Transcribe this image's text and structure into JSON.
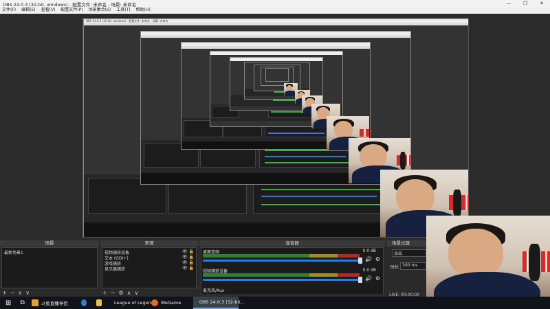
{
  "window": {
    "title": "OBS 24.0.3 (32-bit, windows) - 配置文件: 未命名 - 场景: 未命名",
    "minimize": "—",
    "maximize": "❐",
    "close": "✕"
  },
  "menu": [
    "文件(F)",
    "编辑(E)",
    "查看(V)",
    "配置文件(P)",
    "场景集合(S)",
    "工具(T)",
    "帮助(H)"
  ],
  "nested": {
    "title": "OBS 24.0.3 (32-bit, windows) - 配置文件: 未命名 - 场景: 未命名"
  },
  "scenes": {
    "header": "场景",
    "items": [
      "最新场景1"
    ],
    "tools": [
      "+",
      "−",
      "∧",
      "∨"
    ]
  },
  "sources": {
    "header": "来源",
    "items": [
      "视频捕获设备",
      "文本 (GDI+)",
      "游戏捕获",
      "显示器捕获"
    ],
    "tools": [
      "+",
      "−",
      "⚙",
      "∧",
      "∨"
    ]
  },
  "mixer": {
    "header": "混音器",
    "items": [
      {
        "name": "桌面音频",
        "db": "0.0 dB"
      },
      {
        "name": "视频捕获设备",
        "db": "0.0 dB"
      },
      {
        "name": "麦克风/Aux",
        "db": ""
      }
    ],
    "mute_icon": "🔊",
    "gear_icon": "⚙"
  },
  "transitions": {
    "header": "场景过渡",
    "value": "淡出",
    "duration_label": "时长",
    "duration_value": "300 ms"
  },
  "status": {
    "time": "LIVE: 00:00:00"
  },
  "taskbar": {
    "items": [
      {
        "label": "斗鱼直播伴侣",
        "color": "#e8a033"
      },
      {
        "label": "",
        "color": "#2f7fd6"
      },
      {
        "label": "",
        "color": "#e8c04c"
      },
      {
        "label": "League of Legends",
        "color": "#c8a24a"
      },
      {
        "label": "WeGame",
        "color": "#e06a25"
      },
      {
        "label": "OBS 24.0.3 (32-bit...",
        "color": "#cccccc"
      }
    ]
  }
}
